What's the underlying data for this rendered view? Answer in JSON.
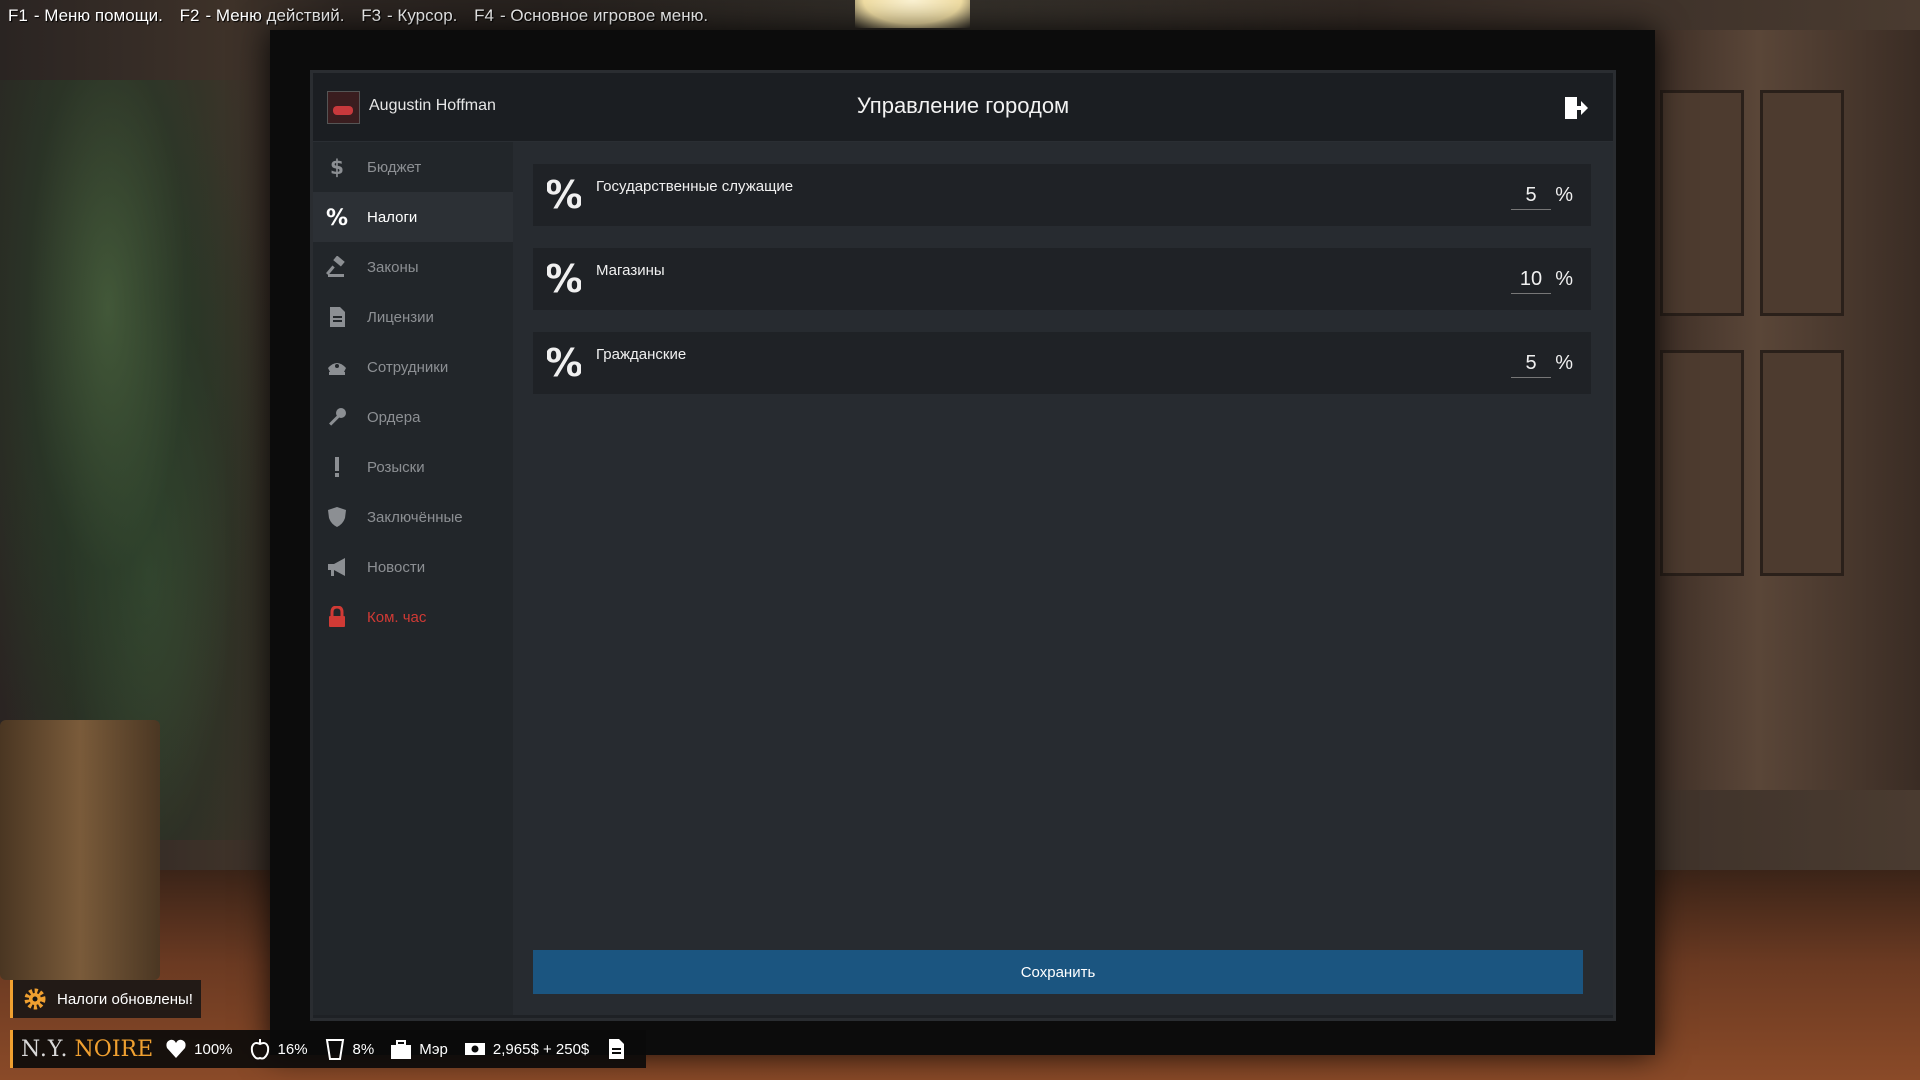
{
  "hints": [
    {
      "key": "F1",
      "text": "- Меню помощи."
    },
    {
      "key": "F2",
      "text": "- Меню действий."
    },
    {
      "key": "F3",
      "text": "- Курсор."
    },
    {
      "key": "F4",
      "text": "- Основное игровое меню."
    }
  ],
  "app": {
    "username": "Augustin Hoffman",
    "title": "Управление городом",
    "exit_icon": "exit-icon"
  },
  "sidebar": {
    "items": [
      {
        "label": "Бюджет",
        "icon": "dollar-icon"
      },
      {
        "label": "Налоги",
        "icon": "percent-icon",
        "active": true
      },
      {
        "label": "Законы",
        "icon": "gavel-icon"
      },
      {
        "label": "Лицензии",
        "icon": "document-icon"
      },
      {
        "label": "Сотрудники",
        "icon": "police-cap-icon"
      },
      {
        "label": "Ордера",
        "icon": "key-icon"
      },
      {
        "label": "Розыски",
        "icon": "exclamation-icon"
      },
      {
        "label": "Заключённые",
        "icon": "shield-icon"
      },
      {
        "label": "Новости",
        "icon": "megaphone-icon"
      },
      {
        "label": "Ком. час",
        "icon": "lock-icon",
        "color": "#d03a35"
      }
    ]
  },
  "taxes": [
    {
      "label": "Государственные служащие",
      "value": "5",
      "unit": "%"
    },
    {
      "label": "Магазины",
      "value": "10",
      "unit": "%"
    },
    {
      "label": "Гражданские",
      "value": "5",
      "unit": "%"
    }
  ],
  "save_label": "Сохранить",
  "toast": {
    "text": "Налоги обновлены!",
    "icon": "gear-icon"
  },
  "hud": {
    "logo_ny": "N.Y.",
    "logo_noire": "NOIRE",
    "health": "100%",
    "hunger": "16%",
    "thirst": "8%",
    "job": "Мэр",
    "money": "2,965$ + 250$",
    "accent": "#f0a030"
  }
}
